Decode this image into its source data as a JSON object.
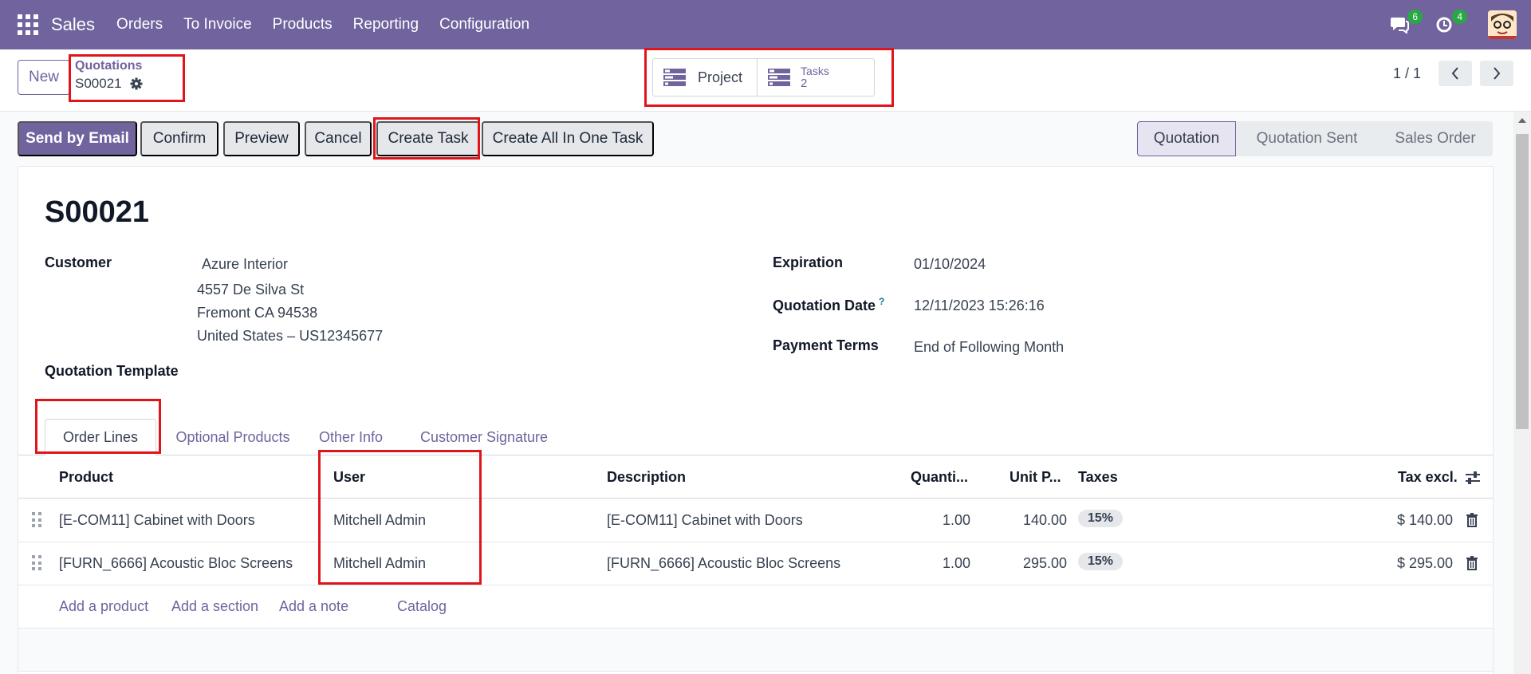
{
  "navbar": {
    "app_name": "Sales",
    "menu": [
      "Orders",
      "To Invoice",
      "Products",
      "Reporting",
      "Configuration"
    ],
    "messages_badge": "6",
    "activities_badge": "4",
    "bg_color": "#71639e"
  },
  "control": {
    "new_label": "New",
    "breadcrumb_parent": "Quotations",
    "breadcrumb_current": "S00021",
    "smart_project_label": "Project",
    "smart_tasks_label": "Tasks",
    "smart_tasks_count": "2",
    "pager": "1 / 1"
  },
  "actions": {
    "send_email": "Send by Email",
    "confirm": "Confirm",
    "preview": "Preview",
    "cancel": "Cancel",
    "create_task": "Create Task",
    "create_all": "Create All In One Task"
  },
  "statusbar": [
    "Quotation",
    "Quotation Sent",
    "Sales Order"
  ],
  "form": {
    "title": "S00021",
    "customer_label": "Customer",
    "customer_name": "Azure Interior",
    "customer_addr1": "4557 De Silva St",
    "customer_addr2": "Fremont CA 94538",
    "customer_addr3": "United States – US12345677",
    "template_label": "Quotation Template",
    "expiration_label": "Expiration",
    "expiration_value": "01/10/2024",
    "qdate_label": "Quotation Date",
    "qdate_help": "?",
    "qdate_value": "12/11/2023 15:26:16",
    "terms_label": "Payment Terms",
    "terms_value": "End of Following Month"
  },
  "tabs": [
    "Order Lines",
    "Optional Products",
    "Other Info",
    "Customer Signature"
  ],
  "table": {
    "headers": {
      "product": "Product",
      "user": "User",
      "description": "Description",
      "quantity": "Quanti...",
      "unit_price": "Unit P...",
      "taxes": "Taxes",
      "subtotal": "Tax excl."
    },
    "rows": [
      {
        "product": "[E-COM11] Cabinet with Doors",
        "user": "Mitchell Admin",
        "description": "[E-COM11] Cabinet with Doors",
        "quantity": "1.00",
        "unit_price": "140.00",
        "tax": "15%",
        "subtotal": "$ 140.00"
      },
      {
        "product": "[FURN_6666] Acoustic Bloc Screens",
        "user": "Mitchell Admin",
        "description": "[FURN_6666] Acoustic Bloc Screens",
        "quantity": "1.00",
        "unit_price": "295.00",
        "tax": "15%",
        "subtotal": "$ 295.00"
      }
    ],
    "add_links": {
      "add_product": "Add a product",
      "add_section": "Add a section",
      "add_note": "Add a note",
      "catalog": "Catalog"
    }
  }
}
